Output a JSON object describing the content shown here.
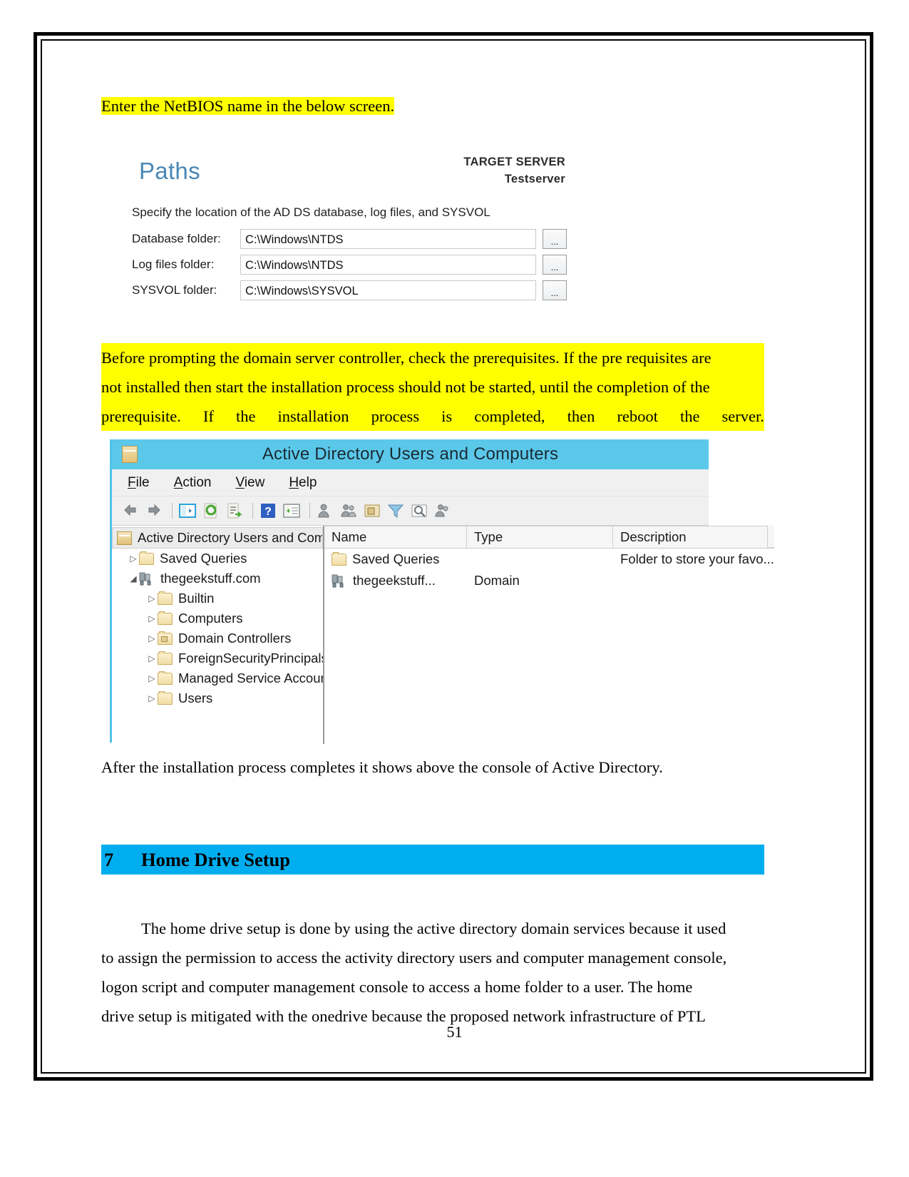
{
  "document": {
    "page_number": "51",
    "intro_line": "Enter the NetBIOS name in the below screen.",
    "paths_dialog": {
      "title": "Paths",
      "target_server_label": "TARGET SERVER",
      "target_server_name": "Testserver",
      "instruction": "Specify the location of the AD DS database, log files, and SYSVOL",
      "browse_label": "...",
      "fields": [
        {
          "label": "Database folder:",
          "value": "C:\\Windows\\NTDS"
        },
        {
          "label": "Log files folder:",
          "value": "C:\\Windows\\NTDS"
        },
        {
          "label": "SYSVOL folder:",
          "value": "C:\\Windows\\SYSVOL"
        }
      ]
    },
    "highlighted_paragraph": {
      "line1": "Before prompting the domain server controller, check the prerequisites. If the pre requisites are",
      "line2": "not installed then start the installation process should not be started, until the completion of the",
      "line3_words": [
        "prerequisite.",
        "If",
        "the",
        "installation",
        "process",
        "is",
        "completed,",
        "then",
        "reboot",
        "the",
        "server."
      ]
    },
    "aduc_window": {
      "title": "Active Directory Users and Computers",
      "app_icon": "console-icon",
      "menus": [
        {
          "accel": "F",
          "rest": "ile"
        },
        {
          "accel": "A",
          "rest": "ction"
        },
        {
          "accel": "V",
          "rest": "iew"
        },
        {
          "accel": "H",
          "rest": "elp"
        }
      ],
      "toolbar_icons": [
        "back-arrow-icon",
        "forward-arrow-icon",
        "show-hide-tree-icon",
        "refresh-icon",
        "export-list-icon",
        "help-icon",
        "properties-icon",
        "new-user-icon",
        "new-group-icon",
        "new-ou-icon",
        "filter-icon",
        "find-icon",
        "delegate-control-icon"
      ],
      "tree": {
        "root": {
          "label": "Active Directory Users and Com",
          "icon": "console-icon"
        },
        "items": [
          {
            "label": "Saved Queries",
            "icon": "folder-icon",
            "expander": "collapsed",
            "level": 1
          },
          {
            "label": "thegeekstuff.com",
            "icon": "domain-icon",
            "expander": "expanded",
            "level": 1
          },
          {
            "label": "Builtin",
            "icon": "folder-icon",
            "expander": "collapsed",
            "level": 2
          },
          {
            "label": "Computers",
            "icon": "folder-icon",
            "expander": "collapsed",
            "level": 2
          },
          {
            "label": "Domain Controllers",
            "icon": "ou-folder-icon",
            "expander": "collapsed",
            "level": 2
          },
          {
            "label": "ForeignSecurityPrincipals",
            "icon": "folder-icon",
            "expander": "collapsed",
            "level": 2
          },
          {
            "label": "Managed Service Accounts",
            "icon": "folder-icon",
            "expander": "collapsed",
            "level": 2
          },
          {
            "label": "Users",
            "icon": "folder-icon",
            "expander": "collapsed",
            "level": 2
          }
        ]
      },
      "list": {
        "columns": [
          "Name",
          "Type",
          "Description"
        ],
        "rows": [
          {
            "name": "Saved Queries",
            "type": "",
            "description": "Folder to store your favo...",
            "icon": "folder-icon"
          },
          {
            "name": "thegeekstuff...",
            "type": "Domain",
            "description": "",
            "icon": "domain-icon"
          }
        ]
      }
    },
    "after_install_line": "After the installation process completes it shows above the console of Active Directory.",
    "section_heading": {
      "number": "7",
      "title": "Home Drive Setup",
      "bar_color": "#00aeef"
    },
    "body_paragraph": {
      "line1": "The home drive setup is done by using the active directory domain services because it used",
      "line2": "to assign the permission to access the activity directory users and computer management console,",
      "line3": "logon script and computer management console to access a home folder to a user. The home",
      "line4": "drive setup is mitigated with the onedrive because the proposed network infrastructure of PTL"
    },
    "colors": {
      "highlight": "#ffff00",
      "heading_bar": "#00aeef",
      "window_titlebar": "#5bc8ea",
      "paths_title": "#4a87b5"
    }
  }
}
